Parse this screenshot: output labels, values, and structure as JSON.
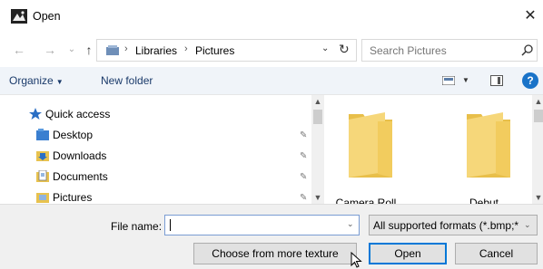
{
  "window": {
    "title": "Open",
    "close_glyph": "✕"
  },
  "navigation": {
    "back_glyph": "←",
    "forward_glyph": "→",
    "recent_glyph": "⌄",
    "up_glyph": "↑"
  },
  "address": {
    "crumbs": [
      "Libraries",
      "Pictures"
    ],
    "separator": "›",
    "dropdown_glyph": "⌄",
    "refresh_glyph": "↻"
  },
  "search": {
    "placeholder": "Search Pictures"
  },
  "toolbar": {
    "organize_label": "Organize",
    "organize_caret": "▼",
    "new_folder_label": "New folder",
    "view_caret": "▼",
    "help_glyph": "?"
  },
  "nav_pane": {
    "items": [
      {
        "label": "Quick access",
        "icon": "star-icon",
        "pinned": false
      },
      {
        "label": "Desktop",
        "icon": "desktop-folder-icon",
        "pinned": true
      },
      {
        "label": "Downloads",
        "icon": "downloads-folder-icon",
        "pinned": true
      },
      {
        "label": "Documents",
        "icon": "documents-folder-icon",
        "pinned": true
      },
      {
        "label": "Pictures",
        "icon": "pictures-folder-icon",
        "pinned": true
      }
    ],
    "pin_glyph": "✎"
  },
  "files": [
    {
      "name": "Camera Roll",
      "icon": "folder-icon"
    },
    {
      "name": "Debut",
      "icon": "folder-icon"
    }
  ],
  "scroll": {
    "up_glyph": "▲",
    "down_glyph": "▼"
  },
  "bottom": {
    "file_name_label": "File name:",
    "file_name_value": "",
    "filter_text": "All supported formats (*.bmp;*.",
    "dropdown_glyph": "⌄",
    "more_types_label": "Choose from more texture types...",
    "open_label": "Open",
    "cancel_label": "Cancel"
  },
  "colors": {
    "accent": "#0078d7",
    "toolbar_bg": "#f0f4f9",
    "folder_yellow": "#f6d77a",
    "folder_shade": "#e8bf4a"
  }
}
